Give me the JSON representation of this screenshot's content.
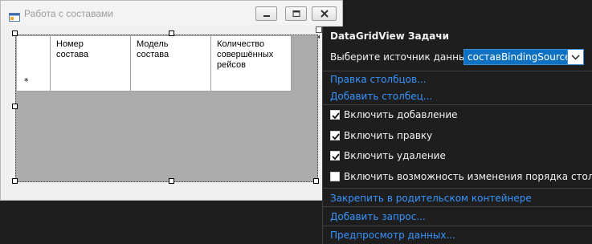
{
  "form": {
    "title": "Работа с составами",
    "icons": {
      "app": "form-icon",
      "minimize": "minimize-icon",
      "maximize": "maximize-icon",
      "close": "close-icon"
    }
  },
  "grid": {
    "columns": [
      "Номер состава",
      "Модель состава",
      "Количество совершённых рейсов"
    ],
    "new_row_marker": "*"
  },
  "tasks": {
    "title": "DataGridView Задачи",
    "datasource_label": "Выберите источник данных:",
    "datasource_value": "составBindingSource",
    "edit_columns": "Правка столбцов...",
    "add_column": "Добавить столбец...",
    "enable_adding": "Включить добавление",
    "enable_editing": "Включить правку",
    "enable_deleting": "Включить удаление",
    "enable_reorder": "Включить возможность изменения порядка столбцов",
    "dock": "Закрепить в родительском контейнере",
    "add_query": "Добавить запрос...",
    "preview": "Предпросмотр данных...",
    "checks": {
      "adding": true,
      "editing": true,
      "deleting": true,
      "reorder": false
    }
  },
  "colors": {
    "accent": "#0e70c0",
    "link": "#3794ff",
    "panel_bg": "#1e1e1e"
  }
}
